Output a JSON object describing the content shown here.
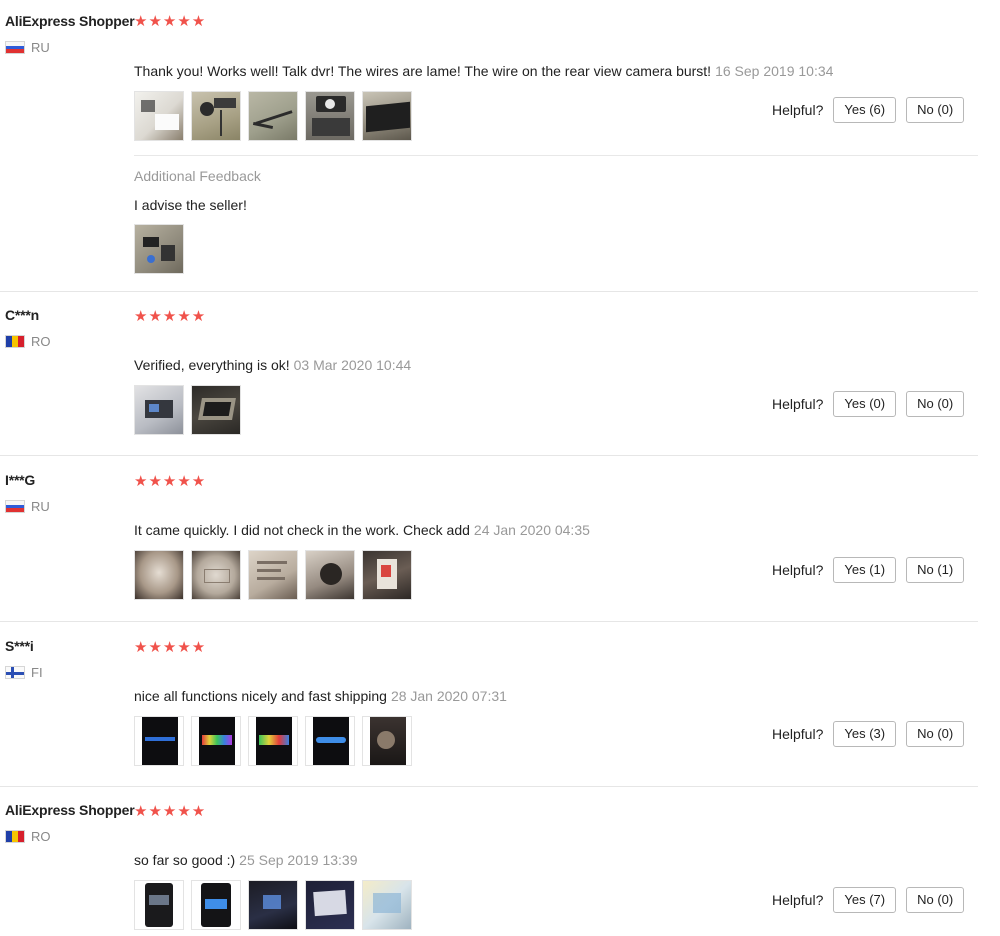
{
  "helpful_label": "Helpful?",
  "star_glyph": "★★★★★",
  "star_color": "#f0524b",
  "reviews": [
    {
      "name": "AliExpress Shopper",
      "country": "RU",
      "rating": 5,
      "text": "Thank you! Works well! Talk dvr! The wires are lame! The wire on the rear view camera burst!",
      "date": "16 Sep 2019 10:34",
      "photo_count": 5,
      "yes": "Yes (6)",
      "no": "No (0)",
      "additional": {
        "title": "Additional Feedback",
        "text": "I advise the seller!",
        "photo_count": 1
      }
    },
    {
      "name": "C***n",
      "country": "RO",
      "rating": 5,
      "text": "Verified, everything is ok!",
      "date": "03 Mar 2020 10:44",
      "photo_count": 2,
      "yes": "Yes (0)",
      "no": "No (0)"
    },
    {
      "name": "I***G",
      "country": "RU",
      "rating": 5,
      "text": "It came quickly. I did not check in the work. Check add",
      "date": "24 Jan 2020 04:35",
      "photo_count": 5,
      "yes": "Yes (1)",
      "no": "No (1)"
    },
    {
      "name": "S***i",
      "country": "FI",
      "rating": 5,
      "text": "nice all functions nicely and fast shipping",
      "date": "28 Jan 2020 07:31",
      "photo_count": 5,
      "yes": "Yes (3)",
      "no": "No (0)"
    },
    {
      "name": "AliExpress Shopper",
      "country": "RO",
      "rating": 5,
      "text": "so far so good :)",
      "date": "25 Sep 2019 13:39",
      "photo_count": 5,
      "yes": "Yes (7)",
      "no": "No (0)"
    }
  ]
}
